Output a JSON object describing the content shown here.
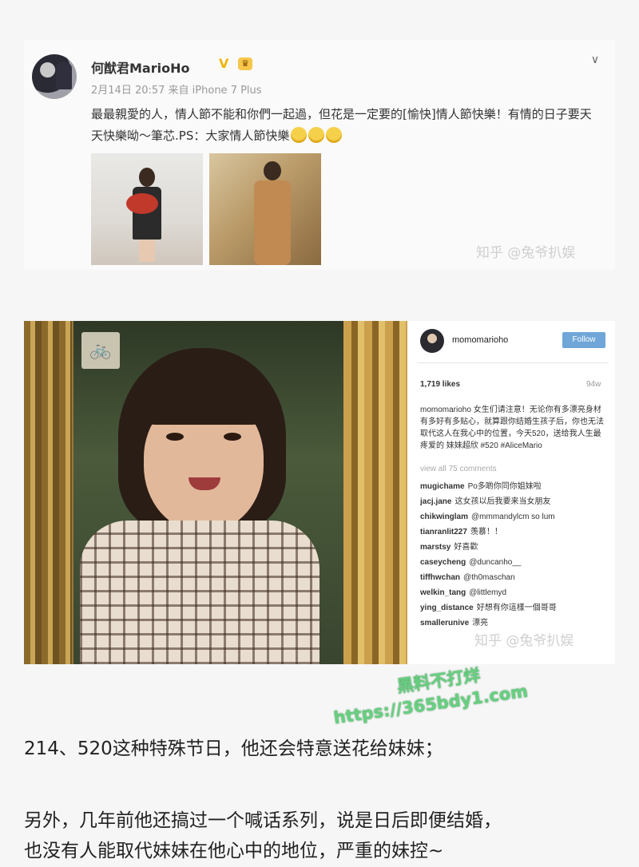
{
  "weibo": {
    "name": "何猷君MarioHo",
    "v_badge": "V",
    "crown_badge": "♛",
    "meta": "2月14日 20:57 来自 iPhone 7 Plus",
    "text": "最最親愛的人，情人節不能和你們一起過，但花是一定要的[愉快]情人節快樂！有情的日子要天天快樂呦～筆芯.PS：大家情人節快樂",
    "watermark": "知乎 @兔爷扒娱"
  },
  "instagram": {
    "bike_sign": "🚲",
    "username": "momomarioho",
    "follow_label": "Follow",
    "likes": "1,719 likes",
    "age": "94w",
    "caption": "momomarioho 女生们请注意！无论你有多漂亮身材有多好有多贴心，就算跟你结婚生孩子后，你也无法取代这人在我心中的位置，今天520，送给我人生最疼爱的 妹妹超欣 #520 #AliceMario",
    "view_all": "view all 75 comments",
    "comments": [
      {
        "user": "mugichame",
        "text": "Po多啲你同你姐妹啦"
      },
      {
        "user": "jacj.jane",
        "text": "这女孩以后我要来当女朋友"
      },
      {
        "user": "chikwinglam",
        "text": "@mmmandylcm so lum"
      },
      {
        "user": "tianranlit227",
        "text": "羡慕！！"
      },
      {
        "user": "marstsy",
        "text": "好喜歡"
      },
      {
        "user": "caseycheng",
        "text": "@duncanho__"
      },
      {
        "user": "tiffhwchan",
        "text": "@th0maschan"
      },
      {
        "user": "welkin_tang",
        "text": "@littlemyd"
      },
      {
        "user": "ying_distance",
        "text": "好想有你這樣一個哥哥"
      },
      {
        "user": "smallerunive",
        "text": "漂亮"
      }
    ],
    "watermark": "知乎 @兔爷扒娱"
  },
  "body": {
    "para1": "214、520这种特殊节日，他还会特意送花给妹妹；",
    "para2_line1": "另外，几年前他还搞过一个喊话系列，说是日后即便结婚，",
    "para2_line2": "也没有人能取代妹妹在他心中的地位，严重的妹控~"
  },
  "overlay_watermark": {
    "line1": "黑料不打烊",
    "line2": "https://365bdy1.com"
  },
  "colors": {
    "follow_button": "#70a6d8",
    "overlay_green": "#66d080",
    "v_badge": "#f2b400"
  }
}
